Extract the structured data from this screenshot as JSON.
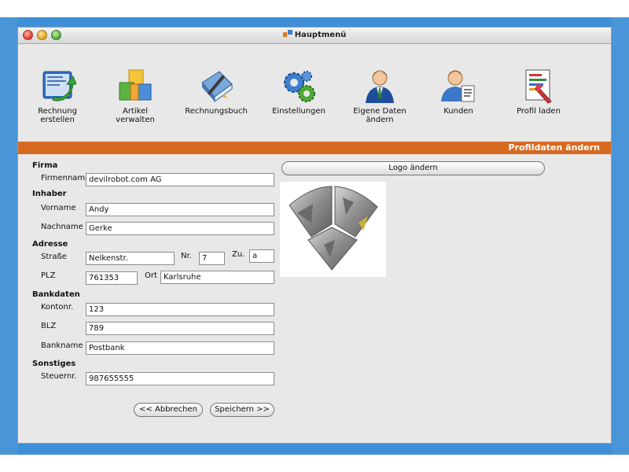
{
  "window": {
    "title": "Hauptmenü"
  },
  "toolbar": {
    "items": [
      {
        "label_line1": "Rechnung",
        "label_line2": "erstellen",
        "icon": "invoice-create-icon"
      },
      {
        "label_line1": "Artikel verwalten",
        "label_line2": "",
        "icon": "boxes-icon"
      },
      {
        "label_line1": "Rechnungsbuch",
        "label_line2": "",
        "icon": "book-pen-icon"
      },
      {
        "label_line1": "Einstellungen",
        "label_line2": "",
        "icon": "gears-icon"
      },
      {
        "label_line1": "Eigene Daten",
        "label_line2": "ändern",
        "icon": "user-business-icon"
      },
      {
        "label_line1": "Kunden",
        "label_line2": "",
        "icon": "customer-icon"
      },
      {
        "label_line1": "Profil laden",
        "label_line2": "",
        "icon": "profile-load-icon"
      }
    ]
  },
  "section": {
    "title": "Profildaten ändern"
  },
  "form": {
    "firma": {
      "heading": "Firma",
      "firmenname_label": "Firmenname",
      "firmenname_value": "devilrobot.com AG"
    },
    "inhaber": {
      "heading": "Inhaber",
      "vorname_label": "Vorname",
      "vorname_value": "Andy",
      "nachname_label": "Nachname",
      "nachname_value": "Gerke"
    },
    "adresse": {
      "heading": "Adresse",
      "strasse_label": "Straße",
      "strasse_value": "Nelkenstr.",
      "nr_label": "Nr.",
      "nr_value": "7",
      "zu_label": "Zu.",
      "zu_value": "a",
      "plz_label": "PLZ",
      "plz_value": "761353",
      "ort_label": "Ort",
      "ort_value": "Karlsruhe"
    },
    "bankdaten": {
      "heading": "Bankdaten",
      "kontonr_label": "Kontonr.",
      "kontonr_value": "123",
      "blz_label": "BLZ",
      "blz_value": "789",
      "bankname_label": "Bankname",
      "bankname_value": "Postbank"
    },
    "sonstiges": {
      "heading": "Sonstiges",
      "steuernr_label": "Steuernr.",
      "steuernr_value": "987655555"
    }
  },
  "buttons": {
    "cancel": "<< Abbrechen",
    "save": "Speichern >>",
    "logo": "Logo ändern"
  },
  "colors": {
    "accent": "#d76a21",
    "desktop": "#3f8fd7"
  }
}
